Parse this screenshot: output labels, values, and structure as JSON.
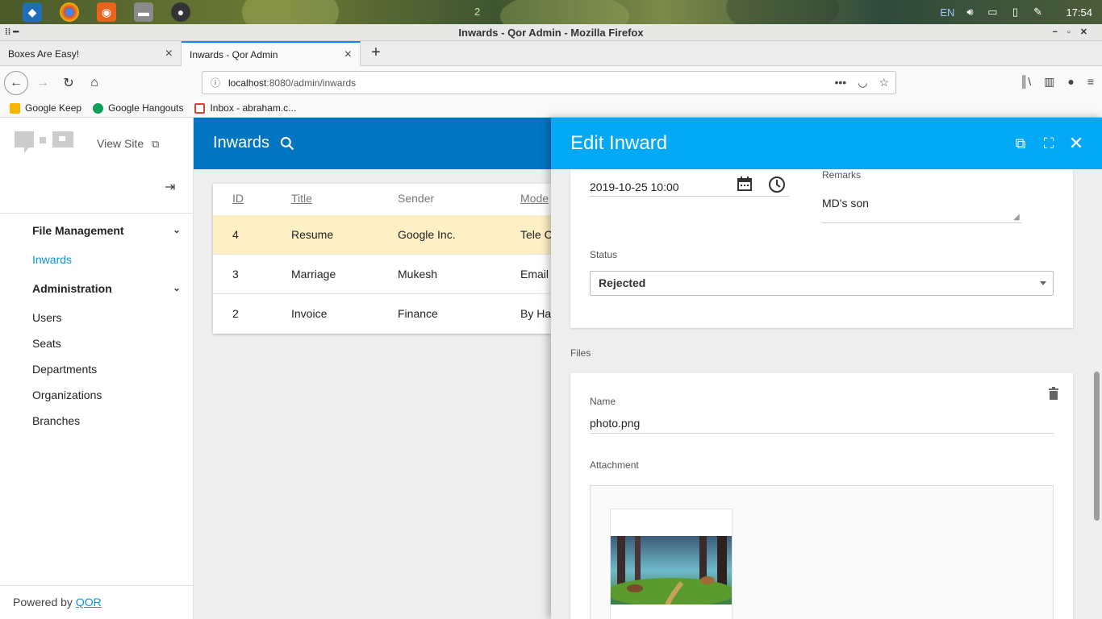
{
  "desktop": {
    "workspace": "2",
    "tray": {
      "language": "EN",
      "clock": "17:54"
    }
  },
  "window": {
    "title": "Inwards - Qor Admin - Mozilla Firefox"
  },
  "browser": {
    "tabs": [
      {
        "label": "Boxes Are Easy!",
        "active": false
      },
      {
        "label": "Inwards - Qor Admin",
        "active": true
      }
    ],
    "url": {
      "host": "localhost",
      "rest": ":8080/admin/inwards"
    },
    "bookmarks": [
      {
        "label": "Google Keep",
        "color": "#f7b500"
      },
      {
        "label": "Google Hangouts",
        "color": "#0f9d58"
      },
      {
        "label": "Inbox - abraham.c...",
        "color": "#db4437"
      }
    ]
  },
  "sidebar": {
    "view_site": "View Site",
    "groups": [
      {
        "label": "File Management",
        "items": [
          "Inwards"
        ]
      },
      {
        "label": "Administration",
        "items": [
          "Users",
          "Seats",
          "Departments",
          "Organizations",
          "Branches"
        ]
      }
    ],
    "active_item": "Inwards",
    "powered_by": "Powered by",
    "powered_link": "QOR"
  },
  "main": {
    "title": "Inwards",
    "columns": [
      "ID",
      "Title",
      "Sender",
      "Mode"
    ],
    "rows": [
      {
        "id": "4",
        "title": "Resume",
        "sender": "Google Inc.",
        "mode": "Tele Ca",
        "highlight": true
      },
      {
        "id": "3",
        "title": "Marriage",
        "sender": "Mukesh",
        "mode": "Email",
        "highlight": false
      },
      {
        "id": "2",
        "title": "Invoice",
        "sender": "Finance",
        "mode": "By Ha",
        "highlight": false
      }
    ]
  },
  "drawer": {
    "title": "Edit Inward",
    "datetime": "2019-10-25 10:00",
    "remarks_label": "Remarks",
    "remarks_value": "MD's son",
    "status_label": "Status",
    "status_value": "Rejected",
    "files_label": "Files",
    "file": {
      "name_label": "Name",
      "name_value": "photo.png",
      "attachment_label": "Attachment"
    }
  },
  "colors": {
    "app_header": "#0175c2",
    "drawer_header": "#03a9f4",
    "active_link": "#0a96e0",
    "row_highlight": "#feefc5"
  }
}
